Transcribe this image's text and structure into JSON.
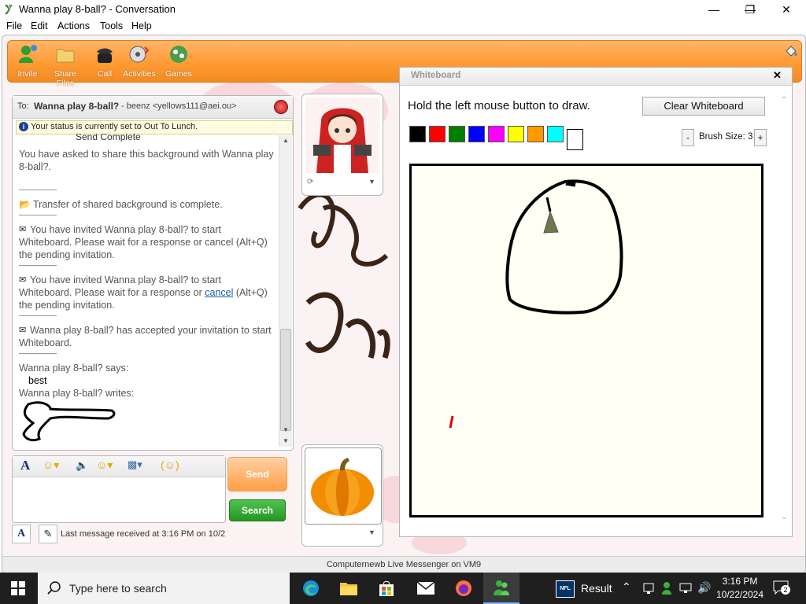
{
  "window": {
    "title": "Wanna play 8-ball? - Conversation"
  },
  "menu": [
    "File",
    "Edit",
    "Actions",
    "Tools",
    "Help"
  ],
  "toolbar": [
    {
      "label": "Invite",
      "icon": "invite-icon"
    },
    {
      "label": "Share Files",
      "icon": "folder-icon"
    },
    {
      "label": "Call",
      "icon": "phone-icon"
    },
    {
      "label": "Activities",
      "icon": "activities-icon"
    },
    {
      "label": "Games",
      "icon": "games-icon"
    }
  ],
  "conversation": {
    "to_prefix": "To:",
    "to_name": "Wanna play 8-ball?",
    "to_detail": "- beenz <yellows111@aei.ou>",
    "status_notice": "Your status is currently set to Out To Lunch.",
    "cut_line": "Send Complete",
    "messages": [
      "You have asked to share this background with Wanna play 8-ball?.",
      "Transfer of shared background is complete.",
      "You have invited Wanna play 8-ball? to start Whiteboard. Please wait for a response or cancel (Alt+Q) the pending invitation.",
      "You have invited Wanna play 8-ball? to start Whiteboard. Please wait for a response or",
      "cancel",
      "(Alt+Q) the pending invitation.",
      "Wanna play 8-ball? has accepted your invitation to start Whiteboard.",
      "Wanna play 8-ball? says:",
      "best",
      "Wanna play 8-ball? writes:"
    ]
  },
  "composer": {
    "send_label": "Send",
    "search_label": "Search",
    "last_message": "Last message received at 3:16 PM on 10/2"
  },
  "whiteboard": {
    "title": "Whiteboard",
    "instruction": "Hold the left mouse button to draw.",
    "clear_label": "Clear Whiteboard",
    "brush_label": "Brush Size: 3",
    "brush_minus": "-",
    "brush_plus": "+",
    "colors": [
      "#000000",
      "#ff0000",
      "#008000",
      "#0000ff",
      "#ff00ff",
      "#ffff00",
      "#ff9900",
      "#00ffff",
      "#ffffff"
    ]
  },
  "status_line": "Computernewb Live Messenger on VM9",
  "taskbar": {
    "search_placeholder": "Type here to search",
    "weather_label": "Result",
    "time": "3:16 PM",
    "date": "10/22/2024",
    "notifications": "2"
  },
  "colors": {
    "toolbar_orange": "#ff9b34",
    "accent_blue": "#1a5fb4",
    "search_green": "#2aa02a"
  }
}
